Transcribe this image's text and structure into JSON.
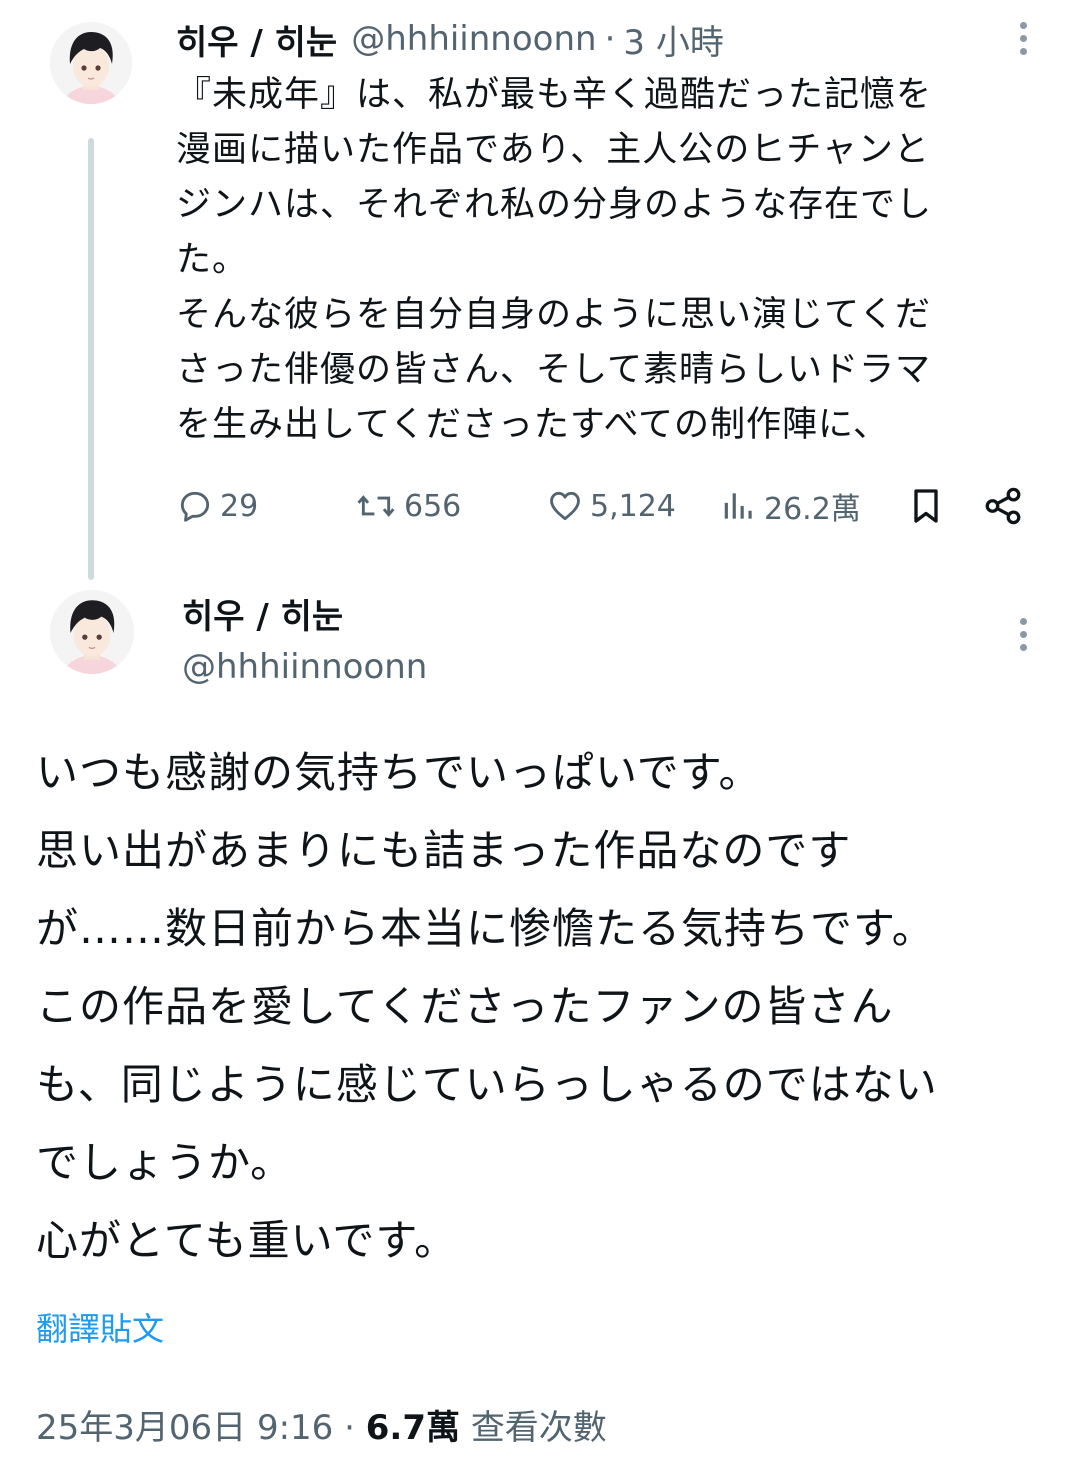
{
  "post1": {
    "display_name": "히우 / 히눈",
    "handle": "@hhhiinnoonn",
    "separator": "·",
    "time": "3 小時",
    "text_lines": [
      "『未成年』は、私が最も辛く過酷だった記憶を",
      "漫画に描いた作品であり、主人公のヒチャンと",
      "ジンハは、それぞれ私の分身のような存在でし",
      "た。",
      "そんな彼らを自分自身のように思い演じてくだ",
      "さった俳優の皆さん、そして素晴らしいドラマ",
      "を生み出してくださったすべての制作陣に、"
    ],
    "actions": {
      "replies": "29",
      "reposts": "656",
      "likes": "5,124",
      "views": "26.2萬"
    }
  },
  "post2": {
    "display_name": "히우 / 히눈",
    "handle": "@hhhiinnoonn",
    "text_lines": [
      "いつも感謝の気持ちでいっぱいです。",
      "思い出があまりにも詰まった作品なのです",
      "が……数日前から本当に惨憺たる気持ちです。",
      "この作品を愛してくださったファンの皆さん",
      "も、同じように感じていらっしゃるのではない",
      "でしょうか。",
      "心がとても重いです。"
    ],
    "translate_label": "翻譯貼文",
    "timestamp": "25年3月06日 9:16",
    "separator": "·",
    "view_count": "6.7萬",
    "view_label": "查看次數"
  },
  "colors": {
    "text": "#0f1419",
    "secondary": "#536471",
    "link": "#1d9bf0",
    "thread_line": "#cfd9de"
  },
  "icons": [
    "reply-icon",
    "repost-icon",
    "like-icon",
    "views-icon",
    "bookmark-icon",
    "share-icon",
    "more-icon"
  ]
}
